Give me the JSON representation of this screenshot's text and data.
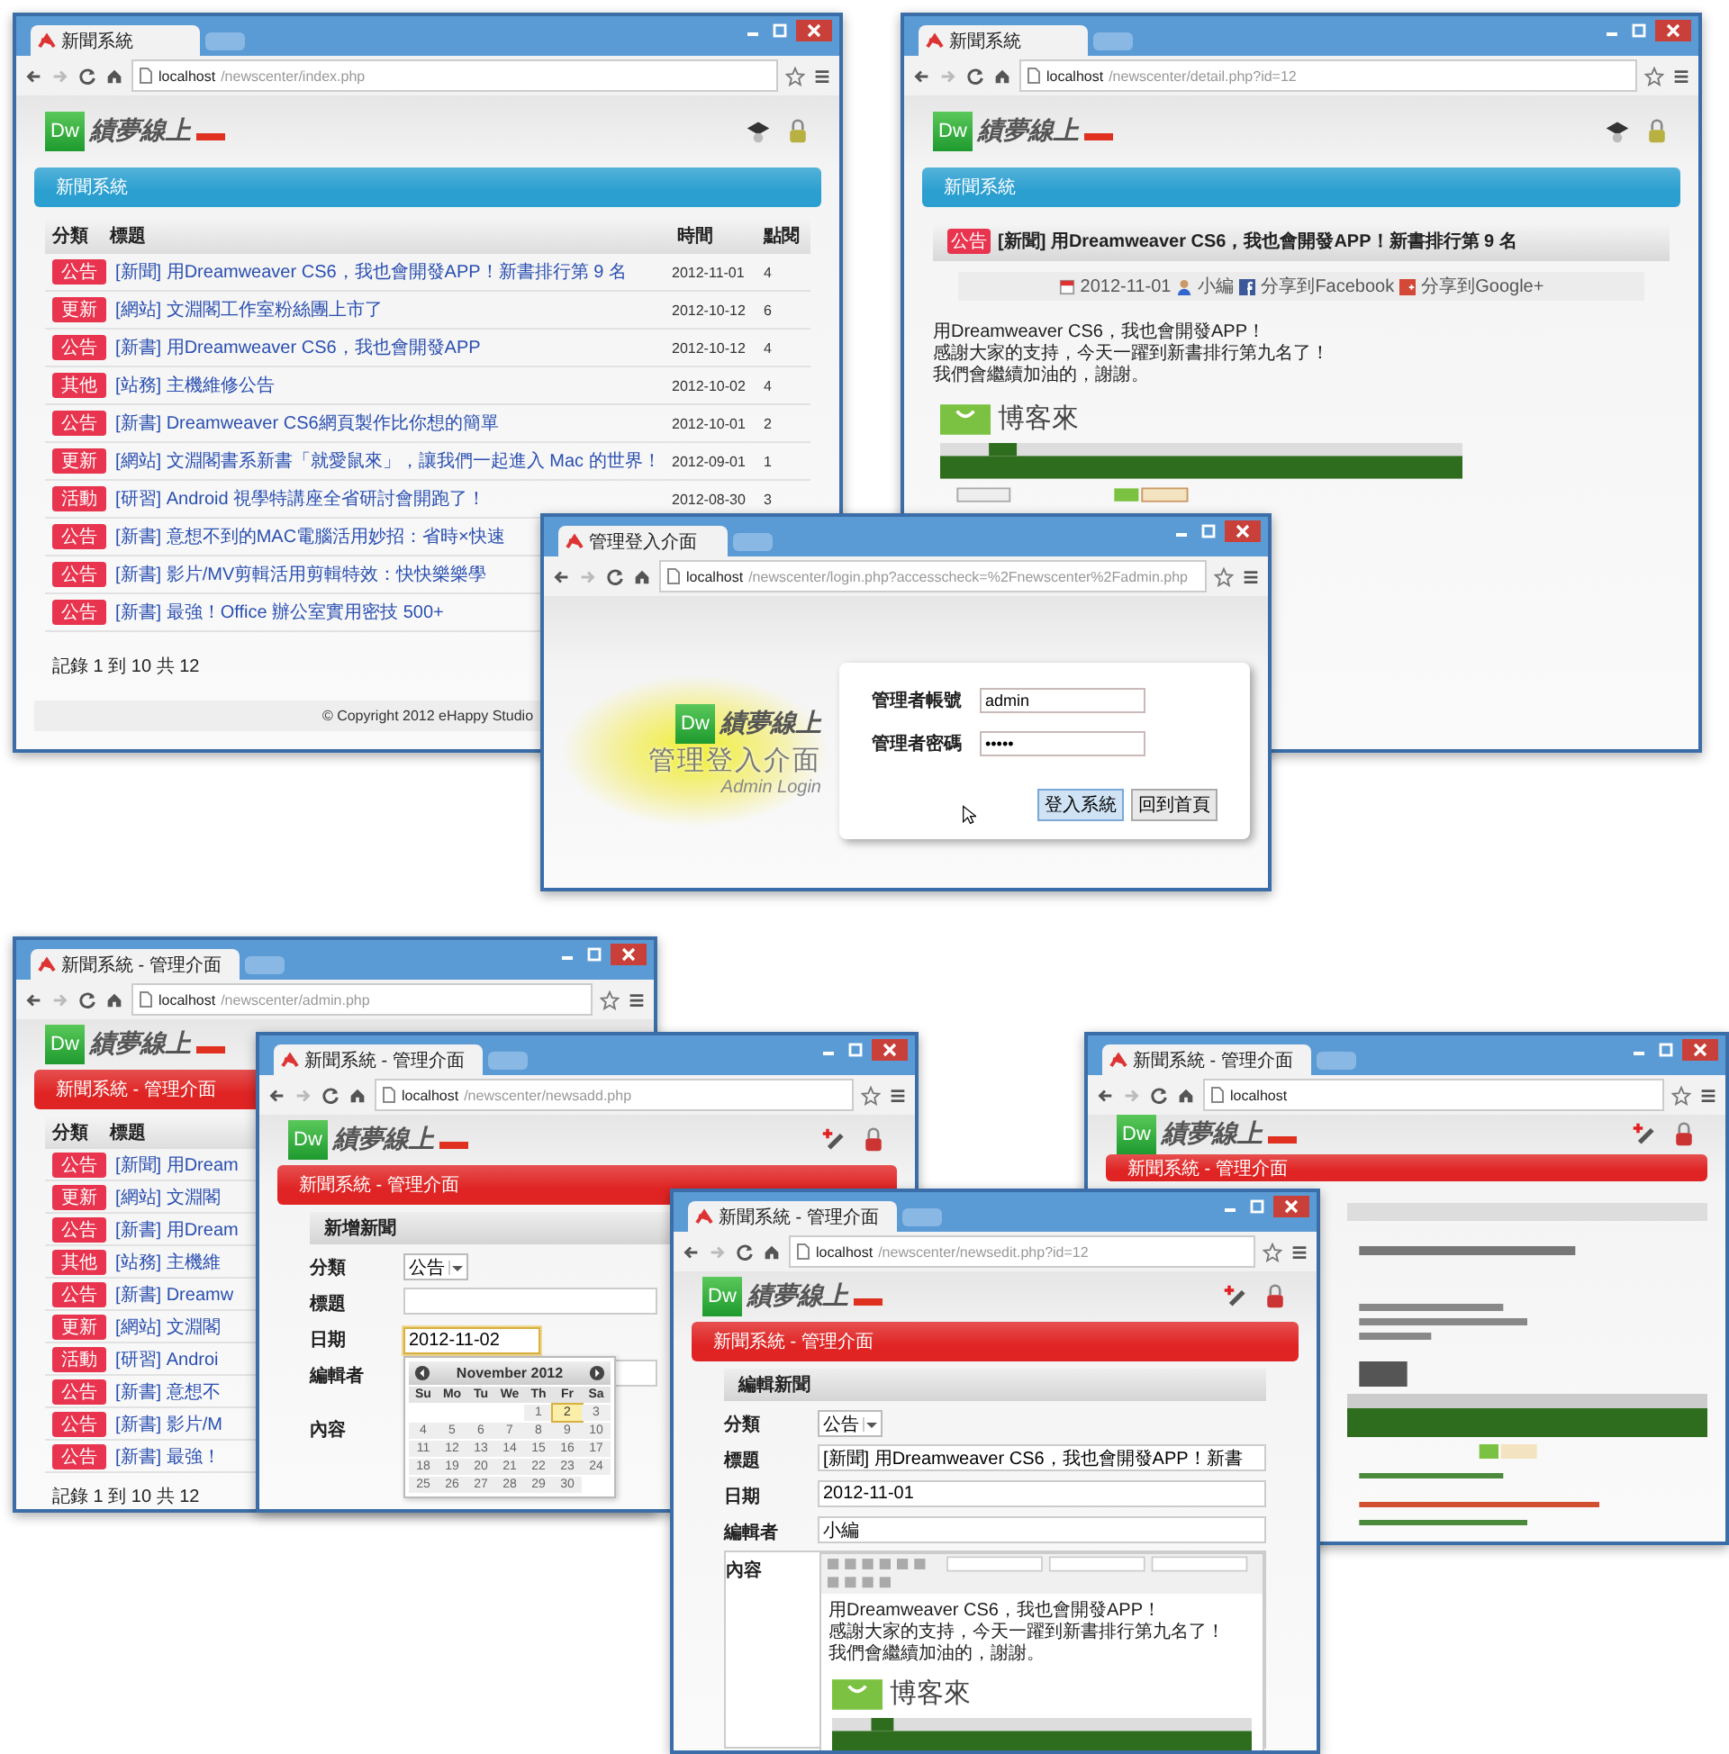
{
  "windows": [
    {
      "kind": "list",
      "admin": false,
      "tab": "新聞系統",
      "host": "localhost",
      "path": "/newscenter/index.php",
      "logo": "Dw",
      "brand": "績夢線上",
      "banner": "新聞系統",
      "columns": [
        "分類",
        "標題",
        "時間",
        "點閱"
      ],
      "rows": [
        {
          "category": "公告",
          "title": "[新聞] 用Dreamweaver CS6，我也會開發APP！新書排行第 9 名",
          "date": "2012-11-01",
          "hits": "4"
        },
        {
          "category": "更新",
          "title": "[網站] 文淵閣工作室粉絲團上市了",
          "date": "2012-10-12",
          "hits": "6"
        },
        {
          "category": "公告",
          "title": "[新書] 用Dreamweaver CS6，我也會開發APP",
          "date": "2012-10-12",
          "hits": "4"
        },
        {
          "category": "其他",
          "title": "[站務] 主機維修公告",
          "date": "2012-10-02",
          "hits": "4"
        },
        {
          "category": "公告",
          "title": "[新書] Dreamweaver CS6網頁製作比你想的簡單",
          "date": "2012-10-01",
          "hits": "2"
        },
        {
          "category": "更新",
          "title": "[網站] 文淵閣書系新書「就愛鼠來」，讓我們一起進入 Mac 的世界！",
          "date": "2012-09-01",
          "hits": "1"
        },
        {
          "category": "活動",
          "title": "[研習] Android 視學特講座全省研討會開跑了！",
          "date": "2012-08-30",
          "hits": "3"
        },
        {
          "category": "公告",
          "title": "[新書] 意想不到的MAC電腦活用妙招：省時×快速"
        },
        {
          "category": "公告",
          "title": "[新書] 影片/MV剪輯活用剪輯特效：快快樂樂學"
        },
        {
          "category": "公告",
          "title": "[新書] 最強！Office 辦公室實用密技 500+"
        }
      ],
      "pager": "記錄 1 到 10 共 12",
      "footer": "© Copyright 2012 eHappy Studio"
    },
    {
      "kind": "detail",
      "admin": false,
      "tab": "新聞系統",
      "host": "localhost",
      "path": "/newscenter/detail.php?id=12",
      "logo": "Dw",
      "brand": "績夢線上",
      "banner": "新聞系統",
      "tag": "公告",
      "headline": "[新聞] 用Dreamweaver CS6，我也會開發APP！新書排行第 9 名",
      "date": "2012-11-01",
      "author": "小編",
      "share": [
        "分享到Facebook",
        "分享到Google+"
      ],
      "body": [
        "用Dreamweaver CS6，我也會開發APP！",
        "感謝大家的支持，今天一躍到新書排行第九名了！",
        "我們會繼續加油的，謝謝。"
      ],
      "blog": "博客來"
    },
    {
      "kind": "login",
      "tab": "管理登入介面",
      "host": "localhost",
      "path": "/newscenter/login.php?accesscheck=%2Fnewscenter%2Fadmin.php",
      "logo": "Dw",
      "brand": "績夢線上",
      "title": "管理登入介面",
      "subtitle": "Admin Login",
      "fields": [
        {
          "label": "管理者帳號",
          "value": "admin"
        },
        {
          "label": "管理者密碼",
          "value": "•••••"
        }
      ],
      "buttons": [
        "登入系統",
        "回到首頁"
      ]
    },
    {
      "kind": "list",
      "admin": true,
      "tab": "新聞系統 - 管理介面",
      "host": "localhost",
      "path": "/newscenter/admin.php",
      "logo": "Dw",
      "brand": "績夢線上",
      "banner": "新聞系統 - 管理介面",
      "columns": [
        "分類",
        "標題"
      ],
      "rows": [
        {
          "category": "公告",
          "title": "[新聞] 用Dream"
        },
        {
          "category": "更新",
          "title": "[網站] 文淵閣"
        },
        {
          "category": "公告",
          "title": "[新書] 用Dream"
        },
        {
          "category": "其他",
          "title": "[站務] 主機維"
        },
        {
          "category": "公告",
          "title": "[新書] Dreamw"
        },
        {
          "category": "更新",
          "title": "[網站] 文淵閣"
        },
        {
          "category": "活動",
          "title": "[研習] Androi"
        },
        {
          "category": "公告",
          "title": "[新書] 意想不"
        },
        {
          "category": "公告",
          "title": "[新書] 影片/M"
        },
        {
          "category": "公告",
          "title": "[新書] 最強！"
        }
      ],
      "pager": "記錄 1 到 10 共 12"
    },
    {
      "kind": "form",
      "admin": true,
      "tab": "新聞系統 - 管理介面",
      "host": "localhost",
      "path": "/newscenter/newsadd.php",
      "logo": "Dw",
      "brand": "績夢線上",
      "banner": "新聞系統 - 管理介面",
      "section": "新增新聞",
      "fields": [
        {
          "kind": "select",
          "label": "分類",
          "value": "公告"
        },
        {
          "kind": "text",
          "label": "標題"
        },
        {
          "kind": "date",
          "label": "日期",
          "value": "2012-11-02",
          "focused": true
        },
        {
          "kind": "text",
          "label": "編輯者"
        },
        {
          "kind": "label",
          "label": "內容"
        }
      ],
      "calendar": {
        "month": "November 2012",
        "weekdays": [
          "Su",
          "Mo",
          "Tu",
          "We",
          "Th",
          "Fr",
          "Sa"
        ],
        "weeks": [
          [
            {
              "day": "1",
              "selected": false
            },
            {
              "day": "2",
              "selected": true
            },
            {
              "day": "3",
              "selected": false
            }
          ],
          [
            {
              "day": "4",
              "selected": false
            },
            {
              "day": "5",
              "selected": false
            },
            {
              "day": "6",
              "selected": false
            },
            {
              "day": "7",
              "selected": false
            },
            {
              "day": "8",
              "selected": false
            },
            {
              "day": "9",
              "selected": false
            },
            {
              "day": "10",
              "selected": false
            }
          ],
          [
            {
              "day": "11",
              "selected": false
            },
            {
              "day": "12",
              "selected": false
            },
            {
              "day": "13",
              "selected": false
            },
            {
              "day": "14",
              "selected": false
            },
            {
              "day": "15",
              "selected": false
            },
            {
              "day": "16",
              "selected": false
            },
            {
              "day": "17",
              "selected": false
            }
          ],
          [
            {
              "day": "18",
              "selected": false
            },
            {
              "day": "19",
              "selected": false
            },
            {
              "day": "20",
              "selected": false
            },
            {
              "day": "21",
              "selected": false
            },
            {
              "day": "22",
              "selected": false
            },
            {
              "day": "23",
              "selected": false
            },
            {
              "day": "24",
              "selected": false
            }
          ],
          [
            {
              "day": "25",
              "selected": false
            },
            {
              "day": "26",
              "selected": false
            },
            {
              "day": "27",
              "selected": false
            },
            {
              "day": "28",
              "selected": false
            },
            {
              "day": "29",
              "selected": false
            },
            {
              "day": "30",
              "selected": false
            }
          ]
        ]
      }
    },
    {
      "kind": "blurred",
      "admin": true,
      "tab": "新聞系統 - 管理介面",
      "host": "localhost",
      "logo": "Dw",
      "brand": "績夢線上",
      "banner": "新聞系統 - 管理介面"
    },
    {
      "kind": "form",
      "admin": true,
      "tab": "新聞系統 - 管理介面",
      "host": "localhost",
      "path": "/newscenter/newsedit.php?id=12",
      "logo": "Dw",
      "brand": "績夢線上",
      "banner": "新聞系統 - 管理介面",
      "section": "編輯新聞",
      "fields": [
        {
          "kind": "select",
          "label": "分類",
          "value": "公告"
        },
        {
          "kind": "text",
          "label": "標題",
          "value": "[新聞] 用Dreamweaver CS6，我也會開發APP！新書"
        },
        {
          "kind": "text",
          "label": "日期",
          "value": "2012-11-01"
        },
        {
          "kind": "text",
          "label": "編輯者",
          "value": "小編"
        },
        {
          "kind": "editor",
          "label": "內容",
          "lines": [
            "用Dreamweaver CS6，我也會開發APP！",
            "感謝大家的支持，今天一躍到新書排行第九名了！",
            "我們會繼續加油的，謝謝。"
          ],
          "blog": "博客來"
        }
      ]
    }
  ]
}
